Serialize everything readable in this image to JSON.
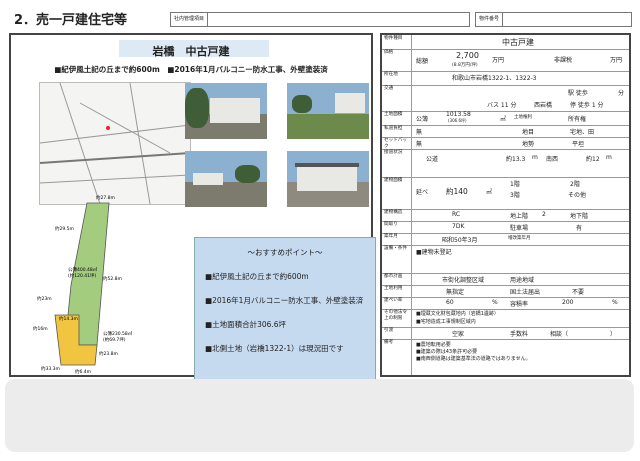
{
  "header": {
    "title": "2．売一戸建住宅等",
    "mgmt_label": "社内管理項目",
    "item_no_label": "物件番号"
  },
  "left": {
    "headline": "岩橋　中古戸建",
    "subline": "■紀伊風土記の丘まで約600m　■2016年1月バルコニー防水工事、外壁塗装済",
    "plot": {
      "area1": "公簿400.48㎡\n(約120.41坪)",
      "area2": "公簿230.58㎡\n(約69.7坪)",
      "dims": [
        "约27.8m",
        "约29.5m",
        "约52.8m",
        "约23m",
        "约16m",
        "约14.3m",
        "约23.8m",
        "约33.3m",
        "约6.4m"
      ]
    },
    "points": {
      "title": "～おすすめポイント～",
      "items": [
        "■紀伊風土記の丘まで約600m",
        "■2016年1月バルコニー防水工事、外壁塗装済",
        "■土地面積合計306.6坪",
        "■北側土地（岩橋1322-1）は現況田です"
      ]
    }
  },
  "right": {
    "name_label": "物件種目",
    "name": "中古戸建",
    "price_label": "価格",
    "price_sub": "総額",
    "price": "2,700",
    "price_unit": "万円",
    "price_tsubo": "(8.8万円/坪)",
    "tax_label": "非課税",
    "tax_unit": "万円",
    "loc_label": "所在地",
    "loc": "和歌山市岩橋1322-1、1322-3",
    "traffic_label": "交通",
    "station": "駅 徒歩",
    "station_min": "分",
    "bus": "バス 11 分",
    "bus_stop": "西岩橋",
    "bus_walk": "停 徒歩 1 分",
    "land_area_label": "土地面積",
    "land_area_kind": "公簿",
    "land_area": "1013.58",
    "land_area_unit": "㎡",
    "land_area_tsubo": "(306.6坪)",
    "land_right_label": "土地権利",
    "land_right": "所有権",
    "private_road_label": "私道負担",
    "private_road": "無",
    "chimoku_label": "地目",
    "chimoku": "宅地、田",
    "setback_label": "セットバック",
    "setback": "無",
    "topo_label": "地勢",
    "topo": "平坦",
    "road_label": "接道状況",
    "road_kind": "公道",
    "road_width": "約13.3",
    "road_dir": "南西",
    "road_width2": "約12",
    "road_unit": "m",
    "bldg_label": "建物面積",
    "bldg_kind": "延べ",
    "bldg_area": "約140",
    "bldg_unit": "㎡",
    "floor1": "1階",
    "floor2": "2階",
    "floor3": "3階",
    "other": "その他",
    "struct_label": "建物構造",
    "struct": "RC",
    "floors_label": "地上階",
    "floors": "2",
    "below_label": "地下階",
    "layout_label": "間取り",
    "layout": "7DK",
    "park_label": "駐車場",
    "park": "有",
    "built_label": "築年月",
    "built": "昭和50年3月",
    "extension_label": "増改築年月",
    "remarks_label": "設備・条件",
    "remarks": "■建物未登記",
    "city_label": "都市計画",
    "city": "市街化調整区域",
    "use_label": "用途地域",
    "landuse_label": "土地利用",
    "landuse": "無指定",
    "law_label": "国土法届出",
    "law": "不要",
    "bcr_label": "建ぺい率",
    "bcr": "60",
    "far_label": "容積率",
    "far": "200",
    "pct": "%",
    "limit_label": "その他法令上の制限",
    "limits": [
      "■埋蔵文化財包蔵地内（岩橋1遺跡）",
      "■宅地造成工事規制区域内"
    ],
    "handover_label": "引渡",
    "handover": "空家",
    "commission_label": "手数料",
    "commission": "相談（　　　　　　　）",
    "notes_label": "備考",
    "notes": [
      "■農地転用必要",
      "■建築の際は43条許可必要",
      "■南西側道路は建築基準法の道路ではありません。"
    ]
  }
}
